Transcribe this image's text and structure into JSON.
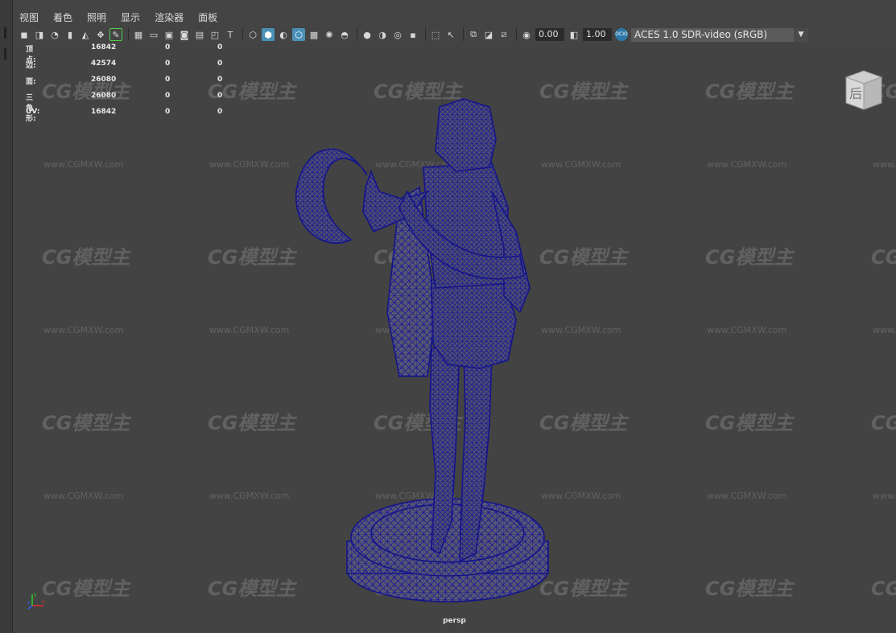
{
  "menubar": {
    "items": [
      "视图",
      "着色",
      "照明",
      "显示",
      "渲染器",
      "面板"
    ]
  },
  "toolbar": {
    "exposure_value": "0.00",
    "gamma_value": "1.00",
    "color_space": "ACES 1.0 SDR-video (sRGB)",
    "color_badge_text": "OCIO",
    "icons": [
      "camera-select",
      "camera-lock",
      "camera-attributes",
      "bookmark",
      "image-plane",
      "2d-pan-zoom",
      "grease-pencil",
      "grid",
      "film-gate",
      "resolution-gate",
      "gate-mask",
      "field-chart",
      "safe-action",
      "safe-title",
      "wireframe",
      "smooth-shade",
      "default-material",
      "wireframe-on-shaded",
      "textured",
      "use-all-lights",
      "shadows",
      "screen-space-ao",
      "motion-blur",
      "anti-aliasing",
      "depth-of-field",
      "isolate-select",
      "xray",
      "xray-active",
      "xray-joints",
      "backface-culling",
      "exposure",
      "gamma",
      "color-management"
    ]
  },
  "hud": {
    "rows": [
      {
        "label": "顶点:",
        "v1": "16842",
        "v2": "0",
        "v3": "0"
      },
      {
        "label": "边:",
        "v1": "42574",
        "v2": "0",
        "v3": "0"
      },
      {
        "label": "面:",
        "v1": "26080",
        "v2": "0",
        "v3": "0"
      },
      {
        "label": "三角形:",
        "v1": "26080",
        "v2": "0",
        "v3": "0"
      },
      {
        "label": "UV:",
        "v1": "16842",
        "v2": "0",
        "v3": "0"
      }
    ]
  },
  "viewcube": {
    "face_label": "后"
  },
  "viewport": {
    "camera_label": "persp",
    "wire_color": "#1a1a9a",
    "bg_color": "#434343"
  },
  "watermark": {
    "logo_text": "CG模型主",
    "url_text": "www.CGMXW.com"
  },
  "axis": {
    "x": "x",
    "y": "y",
    "z": "z"
  }
}
